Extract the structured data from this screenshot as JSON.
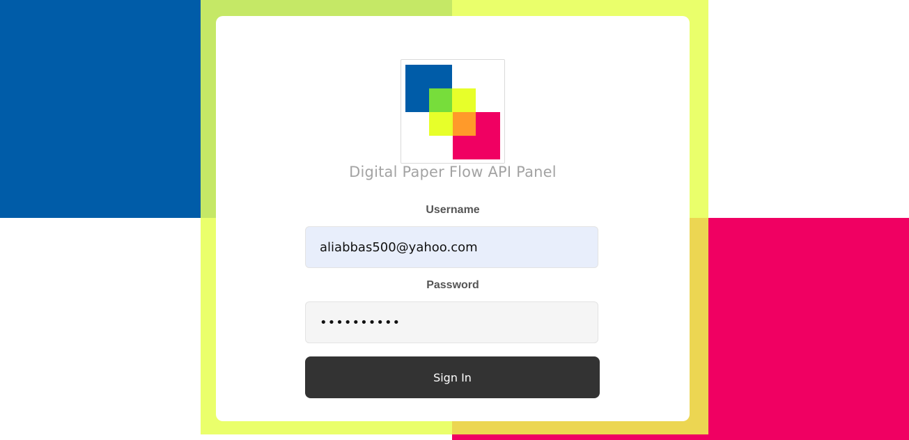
{
  "colors": {
    "blue": "#005ca8",
    "green": "#c5e866",
    "yellow": "#eaff6b",
    "orange": "#ecd652",
    "pink": "#f00062",
    "button": "#333333",
    "title": "#a3a3a3"
  },
  "logo": {
    "icon": "digital-paper-flow-logo"
  },
  "app_title": "Digital Paper Flow API Panel",
  "form": {
    "username_label": "Username",
    "username_value": "aliabbas500@yahoo.com",
    "password_label": "Password",
    "password_value": "••••••••••",
    "submit_label": "Sign In"
  }
}
